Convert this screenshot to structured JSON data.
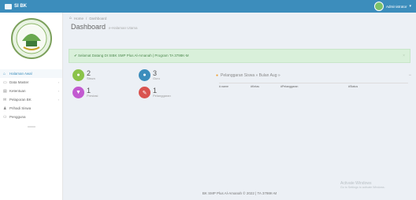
{
  "topbar": {
    "brand": "SI BK",
    "user_name": "Administrator",
    "caret": "▾"
  },
  "sidebar": {
    "items": [
      {
        "label": "Halaman Awal",
        "icon": "home-icon",
        "glyph": "⌂",
        "active": true,
        "has_chevron": false
      },
      {
        "label": "Data Master",
        "icon": "monitor-icon",
        "glyph": "▭",
        "active": false,
        "has_chevron": true
      },
      {
        "label": "Ketentuan",
        "icon": "clipboard-icon",
        "glyph": "▤",
        "active": false,
        "has_chevron": true
      },
      {
        "label": "Pelaporan BK",
        "icon": "chat-icon",
        "glyph": "✉",
        "active": false,
        "has_chevron": true
      },
      {
        "label": "Prihadi Siswa",
        "icon": "user-icon",
        "glyph": "♟",
        "active": false,
        "has_chevron": false
      },
      {
        "label": "Pengguna",
        "icon": "users-icon",
        "glyph": "⚇",
        "active": false,
        "has_chevron": false
      }
    ]
  },
  "breadcrumb": {
    "home": "Home",
    "separator": "/",
    "current": "Dashboard"
  },
  "page": {
    "title": "Dashboard",
    "subtitle": "e-Halaman Utama"
  },
  "alert": {
    "message": "✔ Selamat Datang DI SIBK SMP Plus Al-Amanah | Program TA 3798K-M",
    "close": "×"
  },
  "stats": [
    {
      "name": "siswa",
      "value": "2",
      "label": "Siswa",
      "color": "#8bc34a",
      "icon": "user-icon",
      "glyph": "●"
    },
    {
      "name": "guru",
      "value": "3",
      "label": "Guru",
      "color": "#3c8dbc",
      "icon": "teacher-icon",
      "glyph": "●"
    },
    {
      "name": "prestasi",
      "value": "1",
      "label": "Prestasi",
      "color": "#c25ad0",
      "icon": "trophy-icon",
      "glyph": "▼"
    },
    {
      "name": "pelanggaran",
      "value": "1",
      "label": "Pelanggaran",
      "color": "#d9534f",
      "icon": "gavel-icon",
      "glyph": "✎"
    }
  ],
  "panel": {
    "title": "Pelanggaran Siswa » Bulan Aug »",
    "minus": "−",
    "columns": [
      "#.name",
      "#Kelas",
      "#Pelanggaran",
      "#Status"
    ]
  },
  "footer": {
    "text": "BK SMP Plus Al-Amanah © 2022 | TA 3798K-M"
  },
  "watermark": {
    "line1": "Activate Windows",
    "line2": "Go to Settings to activate Windows."
  },
  "colors": {
    "topbar": "#3c8dbc",
    "alert_bg": "#d9f0da"
  }
}
